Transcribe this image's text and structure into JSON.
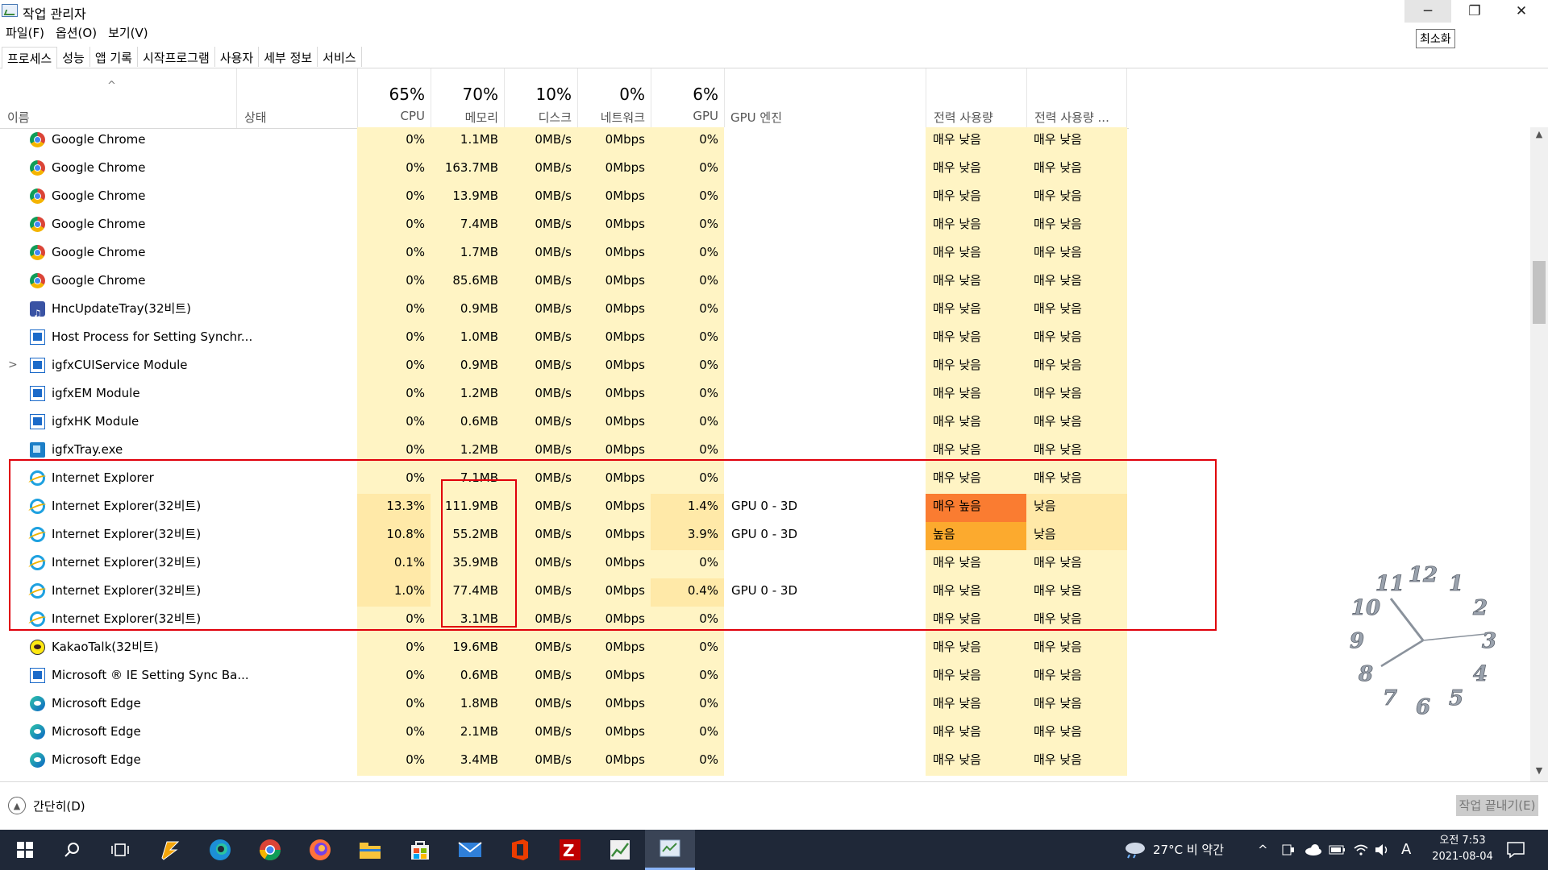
{
  "window": {
    "title": "작업 관리자",
    "tooltip": "최소화"
  },
  "menu": [
    "파일(F)",
    "옵션(O)",
    "보기(V)"
  ],
  "tabs": [
    "프로세스",
    "성능",
    "앱 기록",
    "시작프로그램",
    "사용자",
    "세부 정보",
    "서비스"
  ],
  "header": {
    "name": "이름",
    "status": "상태",
    "cpu_pct": "65%",
    "cpu": "CPU",
    "mem_pct": "70%",
    "mem": "메모리",
    "disk_pct": "10%",
    "disk": "디스크",
    "net_pct": "0%",
    "net": "네트워크",
    "gpu_pct": "6%",
    "gpu": "GPU",
    "gpu_engine": "GPU 엔진",
    "power": "전력 사용량",
    "power_trend": "전력 사용량 ..."
  },
  "rows": [
    {
      "name": "Google Chrome",
      "icon": "chrome-icon",
      "cpu": "0%",
      "mem": "1.1MB",
      "disk": "0MB/s",
      "net": "0Mbps",
      "gpu": "0%",
      "engine": "",
      "power": "매우 낮음",
      "trend": "매우 낮음"
    },
    {
      "name": "Google Chrome",
      "icon": "chrome-icon",
      "cpu": "0%",
      "mem": "163.7MB",
      "disk": "0MB/s",
      "net": "0Mbps",
      "gpu": "0%",
      "engine": "",
      "power": "매우 낮음",
      "trend": "매우 낮음"
    },
    {
      "name": "Google Chrome",
      "icon": "chrome-icon",
      "cpu": "0%",
      "mem": "13.9MB",
      "disk": "0MB/s",
      "net": "0Mbps",
      "gpu": "0%",
      "engine": "",
      "power": "매우 낮음",
      "trend": "매우 낮음"
    },
    {
      "name": "Google Chrome",
      "icon": "chrome-icon",
      "cpu": "0%",
      "mem": "7.4MB",
      "disk": "0MB/s",
      "net": "0Mbps",
      "gpu": "0%",
      "engine": "",
      "power": "매우 낮음",
      "trend": "매우 낮음"
    },
    {
      "name": "Google Chrome",
      "icon": "chrome-icon",
      "cpu": "0%",
      "mem": "1.7MB",
      "disk": "0MB/s",
      "net": "0Mbps",
      "gpu": "0%",
      "engine": "",
      "power": "매우 낮음",
      "trend": "매우 낮음"
    },
    {
      "name": "Google Chrome",
      "icon": "chrome-icon",
      "cpu": "0%",
      "mem": "85.6MB",
      "disk": "0MB/s",
      "net": "0Mbps",
      "gpu": "0%",
      "engine": "",
      "power": "매우 낮음",
      "trend": "매우 낮음"
    },
    {
      "name": "HncUpdateTray(32비트)",
      "icon": "hnc-icon",
      "cpu": "0%",
      "mem": "0.9MB",
      "disk": "0MB/s",
      "net": "0Mbps",
      "gpu": "0%",
      "engine": "",
      "power": "매우 낮음",
      "trend": "매우 낮음"
    },
    {
      "name": "Host Process for Setting Synchr...",
      "icon": "win-icon",
      "cpu": "0%",
      "mem": "1.0MB",
      "disk": "0MB/s",
      "net": "0Mbps",
      "gpu": "0%",
      "engine": "",
      "power": "매우 낮음",
      "trend": "매우 낮음"
    },
    {
      "name": "igfxCUIService Module",
      "icon": "win-icon",
      "expander": ">",
      "cpu": "0%",
      "mem": "0.9MB",
      "disk": "0MB/s",
      "net": "0Mbps",
      "gpu": "0%",
      "engine": "",
      "power": "매우 낮음",
      "trend": "매우 낮음"
    },
    {
      "name": "igfxEM Module",
      "icon": "win-icon",
      "cpu": "0%",
      "mem": "1.2MB",
      "disk": "0MB/s",
      "net": "0Mbps",
      "gpu": "0%",
      "engine": "",
      "power": "매우 낮음",
      "trend": "매우 낮음"
    },
    {
      "name": "igfxHK Module",
      "icon": "win-icon",
      "cpu": "0%",
      "mem": "0.6MB",
      "disk": "0MB/s",
      "net": "0Mbps",
      "gpu": "0%",
      "engine": "",
      "power": "매우 낮음",
      "trend": "매우 낮음"
    },
    {
      "name": "igfxTray.exe",
      "icon": "igfx-icon",
      "cpu": "0%",
      "mem": "1.2MB",
      "disk": "0MB/s",
      "net": "0Mbps",
      "gpu": "0%",
      "engine": "",
      "power": "매우 낮음",
      "trend": "매우 낮음"
    },
    {
      "name": "Internet Explorer",
      "icon": "ie-icon",
      "cpu": "0%",
      "mem": "7.1MB",
      "disk": "0MB/s",
      "net": "0Mbps",
      "gpu": "0%",
      "engine": "",
      "power": "매우 낮음",
      "trend": "매우 낮음"
    },
    {
      "name": "Internet Explorer(32비트)",
      "icon": "ie-icon",
      "cpu": "13.3%",
      "mem": "111.9MB",
      "disk": "0MB/s",
      "net": "0Mbps",
      "gpu": "1.4%",
      "engine": "GPU 0 - 3D",
      "power": "매우 높음",
      "trend": "낮음",
      "hot": "veryhigh"
    },
    {
      "name": "Internet Explorer(32비트)",
      "icon": "ie-icon",
      "cpu": "10.8%",
      "mem": "55.2MB",
      "disk": "0MB/s",
      "net": "0Mbps",
      "gpu": "3.9%",
      "engine": "GPU 0 - 3D",
      "power": "높음",
      "trend": "낮음",
      "hot": "high"
    },
    {
      "name": "Internet Explorer(32비트)",
      "icon": "ie-icon",
      "cpu": "0.1%",
      "mem": "35.9MB",
      "disk": "0MB/s",
      "net": "0Mbps",
      "gpu": "0%",
      "engine": "",
      "power": "매우 낮음",
      "trend": "매우 낮음"
    },
    {
      "name": "Internet Explorer(32비트)",
      "icon": "ie-icon",
      "cpu": "1.0%",
      "mem": "77.4MB",
      "disk": "0MB/s",
      "net": "0Mbps",
      "gpu": "0.4%",
      "engine": "GPU 0 - 3D",
      "power": "매우 낮음",
      "trend": "매우 낮음"
    },
    {
      "name": "Internet Explorer(32비트)",
      "icon": "ie-icon",
      "cpu": "0%",
      "mem": "3.1MB",
      "disk": "0MB/s",
      "net": "0Mbps",
      "gpu": "0%",
      "engine": "",
      "power": "매우 낮음",
      "trend": "매우 낮음"
    },
    {
      "name": "KakaoTalk(32비트)",
      "icon": "kakao-icon",
      "cpu": "0%",
      "mem": "19.6MB",
      "disk": "0MB/s",
      "net": "0Mbps",
      "gpu": "0%",
      "engine": "",
      "power": "매우 낮음",
      "trend": "매우 낮음"
    },
    {
      "name": "Microsoft ® IE Setting Sync Ba...",
      "icon": "win-icon",
      "cpu": "0%",
      "mem": "0.6MB",
      "disk": "0MB/s",
      "net": "0Mbps",
      "gpu": "0%",
      "engine": "",
      "power": "매우 낮음",
      "trend": "매우 낮음"
    },
    {
      "name": "Microsoft Edge",
      "icon": "edge-icon",
      "cpu": "0%",
      "mem": "1.8MB",
      "disk": "0MB/s",
      "net": "0Mbps",
      "gpu": "0%",
      "engine": "",
      "power": "매우 낮음",
      "trend": "매우 낮음"
    },
    {
      "name": "Microsoft Edge",
      "icon": "edge-icon",
      "cpu": "0%",
      "mem": "2.1MB",
      "disk": "0MB/s",
      "net": "0Mbps",
      "gpu": "0%",
      "engine": "",
      "power": "매우 낮음",
      "trend": "매우 낮음"
    },
    {
      "name": "Microsoft Edge",
      "icon": "edge-icon",
      "cpu": "0%",
      "mem": "3.4MB",
      "disk": "0MB/s",
      "net": "0Mbps",
      "gpu": "0%",
      "engine": "",
      "power": "매우 낮음",
      "trend": "매우 낮음"
    }
  ],
  "footer": {
    "collapse": "간단히(D)",
    "end_task": "작업 끝내기(E)"
  },
  "clock_numbers": [
    "12",
    "1",
    "2",
    "3",
    "4",
    "5",
    "6",
    "7",
    "8",
    "9",
    "10",
    "11"
  ],
  "taskbar": {
    "weather": "27°C  비 약간",
    "ime": "A",
    "time": "오전 7:53",
    "date": "2021-08-04"
  },
  "colors": {
    "heat_light": "#fff4c4",
    "heat_mid": "#ffe9a8",
    "very_high": "#fa7c31",
    "high": "#fcaa2e",
    "accent": "#e0000b"
  }
}
